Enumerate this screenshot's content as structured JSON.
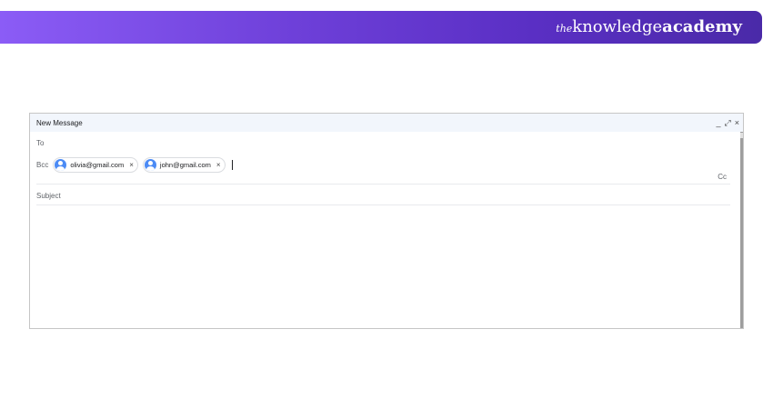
{
  "brand": {
    "prefix": "the",
    "middle": "knowledge",
    "suffix": "academy"
  },
  "compose": {
    "title": "New Message",
    "header_icons": {
      "minimize": "_",
      "expand": "⤢",
      "close": "×"
    },
    "to_label": "To",
    "bcc_label": "Bcc",
    "recipients": [
      {
        "email": "olivia@gmail.com",
        "remove": "×"
      },
      {
        "email": "john@gmail.com",
        "remove": "×"
      }
    ],
    "cc_label": "Cc",
    "subject_placeholder": "Subject"
  },
  "colors": {
    "banner_start": "#8b5cf6",
    "banner_end": "#4a2aa8",
    "avatar": "#4c8bf5",
    "header_bg": "#f2f6fc"
  }
}
